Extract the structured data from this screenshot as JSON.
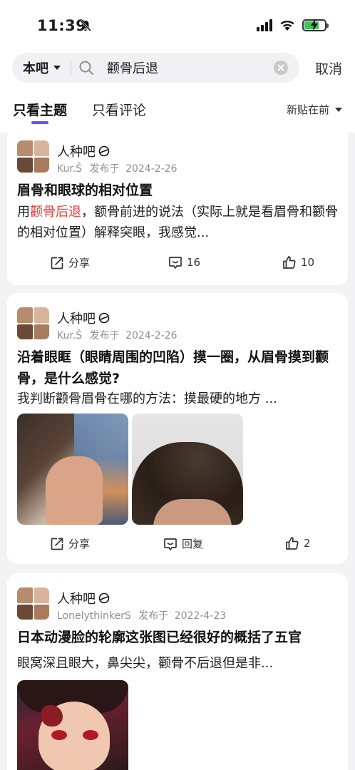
{
  "status_bar": {
    "time": "11:39"
  },
  "search": {
    "scope": "本吧",
    "query": "颧骨后退",
    "cancel": "取消"
  },
  "tabs": {
    "active": "只看主题",
    "inactive": "只看评论",
    "sort": "新贴在前"
  },
  "colors": {
    "accent": "#6b4ff0",
    "highlight": "#e8413b",
    "battery": "#3ac45a"
  },
  "posts": [
    {
      "forum": "人种吧",
      "author": "Kur.Š",
      "posted_label": "发布于",
      "date": "2024-2-26",
      "title": "眉骨和眼球的相对位置",
      "body_pre": "用",
      "body_highlight": "颧骨后退",
      "body_post": "，额骨前进的说法（实际上就是看眉骨和颧骨的相对位置）解释突眼，我感觉...",
      "share": "分享",
      "comments": "16",
      "likes": "10"
    },
    {
      "forum": "人种吧",
      "author": "Kur.Š",
      "posted_label": "发布于",
      "date": "2024-2-26",
      "title": "沿着眼眶（眼睛周围的凹陷）摸一圈，从眉骨摸到颧骨，是什么感觉?",
      "body": "我判断颧骨眉骨在哪的方法：摸最硬的地方 ...",
      "share": "分享",
      "comments": "回复",
      "likes": "2"
    },
    {
      "forum": "人种吧",
      "author": "LonelythinkerS",
      "posted_label": "发布于",
      "date": "2022-4-23",
      "title": "日本动漫脸的轮廓这张图已经很好的概括了五官",
      "body": "眼窝深且眼大，鼻尖尖，颧骨不后退但是非..."
    }
  ]
}
